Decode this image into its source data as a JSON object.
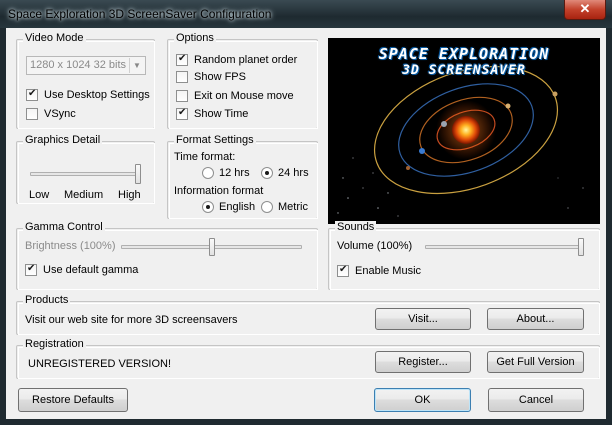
{
  "window": {
    "title": "Space Exploration 3D ScreenSaver Configuration",
    "close_label": "✕"
  },
  "video_mode": {
    "legend": "Video Mode",
    "resolution": "1280 x 1024 32 bits",
    "use_desktop": {
      "label": "Use Desktop Settings",
      "checked": true
    },
    "vsync": {
      "label": "VSync",
      "checked": false
    }
  },
  "options": {
    "legend": "Options",
    "items": [
      {
        "label": "Random planet order",
        "checked": true
      },
      {
        "label": "Show FPS",
        "checked": false
      },
      {
        "label": "Exit on Mouse move",
        "checked": false
      },
      {
        "label": "Show Time",
        "checked": true
      }
    ]
  },
  "preview": {
    "line1": "SPACE EXPLORATION",
    "line2": "3D SCREENSAVER"
  },
  "graphics_detail": {
    "legend": "Graphics Detail",
    "labels": [
      "Low",
      "Medium",
      "High"
    ],
    "level": 1.0
  },
  "format_settings": {
    "legend": "Format Settings",
    "time_format_label": "Time format:",
    "time_options": [
      "12 hrs",
      "24 hrs"
    ],
    "time_selected": 1,
    "info_format_label": "Information format",
    "info_options": [
      "English",
      "Metric"
    ],
    "info_selected": 0
  },
  "gamma": {
    "legend": "Gamma Control",
    "brightness_label": "Brightness (100%)",
    "brightness_value": 0.5,
    "use_default": {
      "label": "Use default gamma",
      "checked": true
    }
  },
  "sounds": {
    "legend": "Sounds",
    "volume_label": "Volume (100%)",
    "volume_value": 1.0,
    "enable_music": {
      "label": "Enable Music",
      "checked": true
    }
  },
  "products": {
    "legend": "Products",
    "text": "Visit our web site for more 3D screensavers",
    "visit_label": "Visit...",
    "about_label": "About..."
  },
  "registration": {
    "legend": "Registration",
    "status": "UNREGISTERED VERSION!",
    "register_label": "Register...",
    "full_label": "Get Full Version"
  },
  "footer": {
    "restore_label": "Restore Defaults",
    "ok_label": "OK",
    "cancel_label": "Cancel"
  }
}
